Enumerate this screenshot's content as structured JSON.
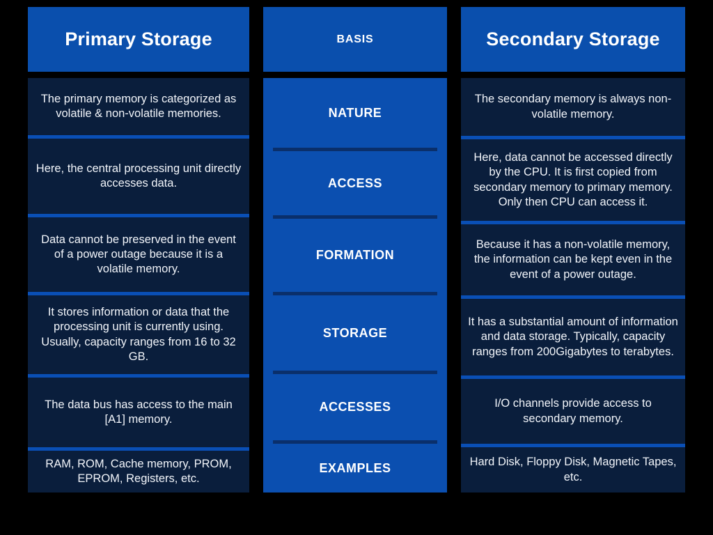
{
  "meta": {
    "background_color": "#000000",
    "header_color": "#0a4fad",
    "body_dark_color": "#0a1e3c",
    "body_mid_color": "#0b4fb0",
    "separator_bright_color": "#0a4fb5",
    "separator_dark_color": "#0a2f6b",
    "text_color": "#f2f5fa"
  },
  "headers": {
    "left": "Primary Storage",
    "middle": "BASIS",
    "right": "Secondary Storage"
  },
  "rows": [
    {
      "basis": "NATURE",
      "primary": "The primary memory is categorized as volatile & non-volatile memories.",
      "secondary": "The secondary memory is always non-volatile memory."
    },
    {
      "basis": "ACCESS",
      "primary": "Here, the central processing unit directly accesses data.",
      "secondary": "Here, data cannot be accessed directly by the CPU. It is first copied from secondary memory to primary memory. Only then CPU can access it."
    },
    {
      "basis": "FORMATION",
      "primary": "Data cannot be preserved in the event of a power outage because it is a volatile memory.",
      "secondary": "Because it has a non-volatile memory, the information can be kept even in the event of a power outage."
    },
    {
      "basis": "STORAGE",
      "primary": "It stores information or data that the processing unit is currently using. Usually, capacity ranges from 16 to 32 GB.",
      "secondary": "It has a substantial amount of information and data storage. Typically, capacity ranges from 200Gigabytes to terabytes."
    },
    {
      "basis": "ACCESSES",
      "primary": "The data bus has access to the main [A1] memory.",
      "secondary": "I/O channels provide access to secondary memory."
    },
    {
      "basis": "EXAMPLES",
      "primary": "RAM, ROM, Cache memory, PROM, EPROM, Registers, etc.",
      "secondary": "Hard Disk, Floppy Disk, Magnetic Tapes, etc."
    }
  ]
}
